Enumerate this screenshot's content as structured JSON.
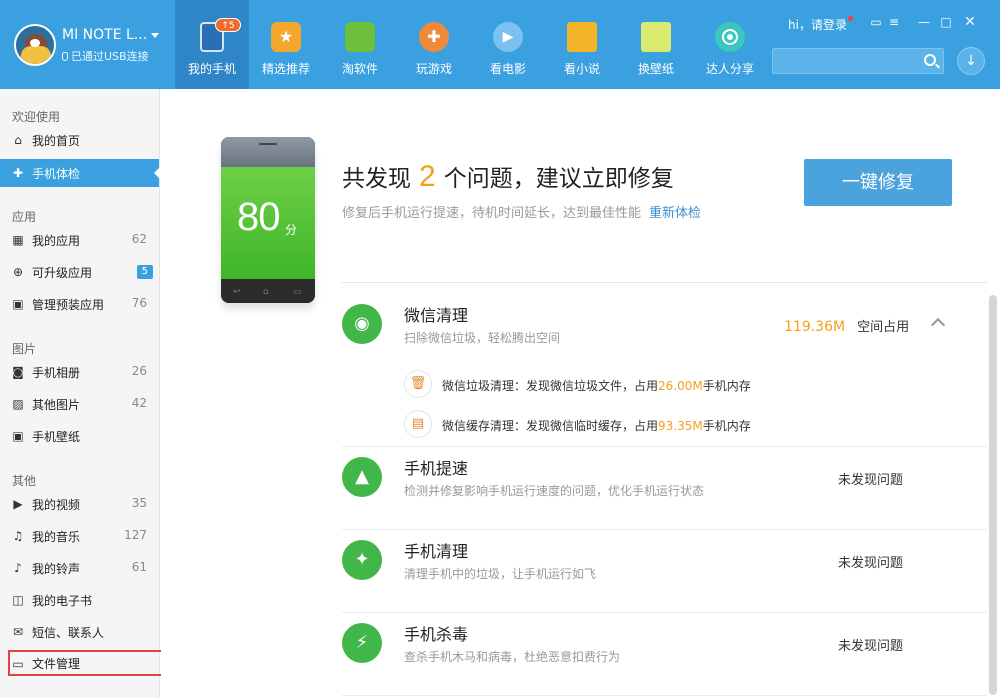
{
  "device": {
    "name": "MI NOTE L...",
    "connection": "已通过USB连接"
  },
  "nav": [
    {
      "label": "我的手机",
      "badge": "↑5",
      "color": "#3b7fc4",
      "icon": "phone-icon"
    },
    {
      "label": "精选推荐",
      "color": "#f3a82d",
      "icon": "star-icon"
    },
    {
      "label": "淘软件",
      "color": "#6bbf3a",
      "icon": "android-icon"
    },
    {
      "label": "玩游戏",
      "color": "#f08a3a",
      "icon": "gamepad-icon"
    },
    {
      "label": "看电影",
      "color": "#4aa7e6",
      "icon": "play-icon"
    },
    {
      "label": "看小说",
      "color": "#f2b529",
      "icon": "book-icon"
    },
    {
      "label": "换壁纸",
      "color": "#b6d94c",
      "icon": "wallpaper-icon"
    },
    {
      "label": "达人分享",
      "color": "#39c7c0",
      "icon": "share-icon"
    }
  ],
  "topright": {
    "greeting": "hi，请登录",
    "search_placeholder": ""
  },
  "sidebar": {
    "sections": [
      {
        "title": "欢迎使用",
        "items": [
          {
            "label": "我的首页",
            "icon": "home-icon",
            "count": ""
          },
          {
            "label": "手机体检",
            "icon": "checkup-icon",
            "count": "",
            "active": true
          }
        ]
      },
      {
        "title": "应用",
        "items": [
          {
            "label": "我的应用",
            "icon": "apps-icon",
            "count": "62"
          },
          {
            "label": "可升级应用",
            "icon": "upgrade-icon",
            "count": "5"
          },
          {
            "label": "管理预装应用",
            "icon": "preinstall-icon",
            "count": "76"
          }
        ]
      },
      {
        "title": "图片",
        "items": [
          {
            "label": "手机相册",
            "icon": "camera-icon",
            "count": "26"
          },
          {
            "label": "其他图片",
            "icon": "image-icon",
            "count": "42"
          },
          {
            "label": "手机壁纸",
            "icon": "wallpaper-icon",
            "count": ""
          }
        ]
      },
      {
        "title": "其他",
        "items": [
          {
            "label": "我的视频",
            "icon": "video-icon",
            "count": "35"
          },
          {
            "label": "我的音乐",
            "icon": "music-icon",
            "count": "127"
          },
          {
            "label": "我的铃声",
            "icon": "bell-icon",
            "count": "61"
          },
          {
            "label": "我的电子书",
            "icon": "ebook-icon",
            "count": ""
          },
          {
            "label": "短信、联系人",
            "icon": "mail-icon",
            "count": ""
          },
          {
            "label": "文件管理",
            "icon": "folder-icon",
            "count": ""
          }
        ]
      }
    ]
  },
  "score": {
    "value": "80",
    "unit": "分"
  },
  "summary": {
    "prefix": "共发现",
    "count": "2",
    "suffix": "个问题，建议立即修复",
    "desc": "修复后手机运行提速，待机时间延长，达到最佳性能",
    "recheck": "重新体检",
    "fix_button": "一键修复"
  },
  "items": [
    {
      "title": "微信清理",
      "desc": "扫除微信垃圾，轻松腾出空间",
      "size": "119.36M",
      "status": "空间占用",
      "subs": [
        {
          "pre": "微信垃圾清理：发现微信垃圾文件，占用",
          "amount": "26.00M",
          "post": "手机内存",
          "icon": "trash-icon"
        },
        {
          "pre": "微信缓存清理：发现微信临时缓存，占用",
          "amount": "93.35M",
          "post": "手机内存",
          "icon": "box-icon"
        }
      ]
    },
    {
      "title": "手机提速",
      "desc": "检测并修复影响手机运行速度的问题，优化手机运行状态",
      "status": "未发现问题"
    },
    {
      "title": "手机清理",
      "desc": "清理手机中的垃圾，让手机运行如飞",
      "status": "未发现问题"
    },
    {
      "title": "手机杀毒",
      "desc": "查杀手机木马和病毒，杜绝恶意扣费行为",
      "status": "未发现问题"
    }
  ]
}
